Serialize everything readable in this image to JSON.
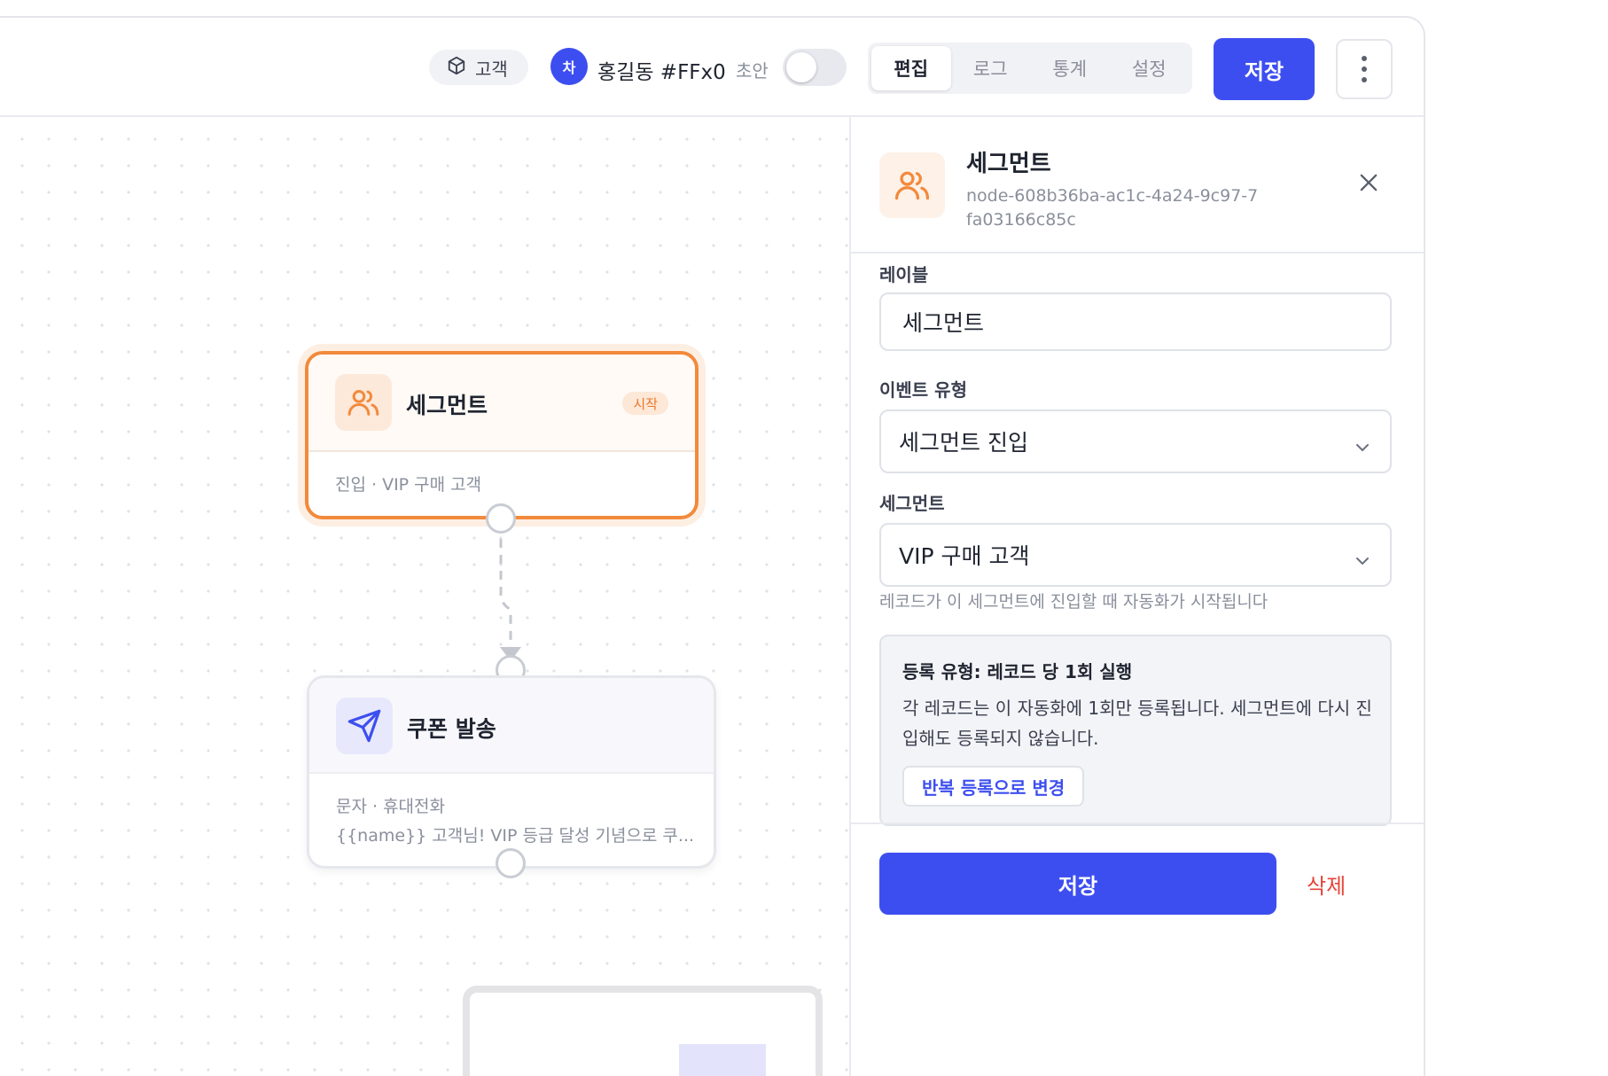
{
  "header": {
    "object_chip_label": "고객",
    "user_avatar_letter": "차",
    "user_name": "홍길동 #FFx0",
    "draft_label": "초안",
    "draft_toggle_on": false,
    "tabs": [
      {
        "label": "편집",
        "active": true
      },
      {
        "label": "로그",
        "active": false
      },
      {
        "label": "통계",
        "active": false
      },
      {
        "label": "설정",
        "active": false
      }
    ],
    "save_label": "저장",
    "more_icon": "more-vertical-icon"
  },
  "canvas": {
    "nodes": [
      {
        "title": "세그먼트",
        "badge": "시작",
        "subtitle": "진입 · VIP 구매 고객",
        "icon": "users-icon",
        "accent": "#f28a3c"
      },
      {
        "title": "쿠폰 발송",
        "subtitle": "문자 · 휴대전화",
        "message": "{{name}} 고객님! VIP 등급 달성 기념으로 쿠...",
        "icon": "send-icon",
        "accent": "#3d4ef0"
      }
    ]
  },
  "panel": {
    "title": "세그먼트",
    "node_id": "node-608b36ba-ac1c-4a24-9c97-7fa03166c85c",
    "close_icon": "close-icon",
    "label_field": {
      "label": "레이블",
      "value": "세그먼트"
    },
    "event_type_field": {
      "label": "이벤트 유형",
      "value": "세그먼트 진입"
    },
    "segment_field": {
      "label": "세그먼트",
      "value": "VIP 구매 고객"
    },
    "helper_text": "레코드가 이 세그먼트에 진입할 때 자동화가 시작됩니다",
    "info": {
      "title": "등록 유형: 레코드 당 1회 실행",
      "body": "각 레코드는 이 자동화에 1회만 등록됩니다. 세그먼트에 다시 진입해도 등록되지 않습니다.",
      "button_label": "반복 등록으로 변경"
    },
    "save_label": "저장",
    "delete_label": "삭제"
  },
  "colors": {
    "primary": "#3d4ef0",
    "segment_accent": "#f28a3c",
    "danger": "#e6453a"
  }
}
